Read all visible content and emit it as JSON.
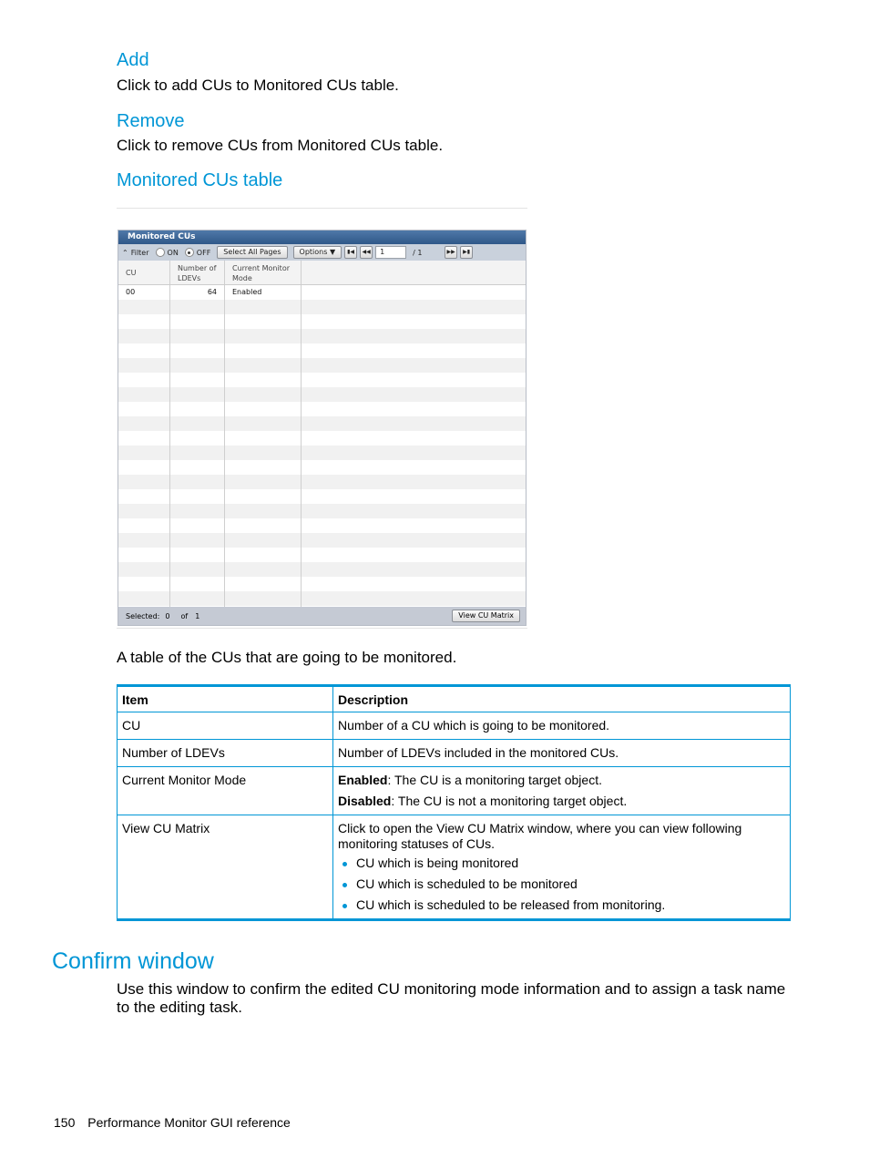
{
  "sections": {
    "add": {
      "title": "Add",
      "text": "Click to add CUs to Monitored CUs table."
    },
    "remove": {
      "title": "Remove",
      "text": "Click to remove CUs from Monitored CUs table."
    },
    "monitored_table": {
      "title": "Monitored CUs table",
      "caption": "A table of the CUs that are going to be monitored."
    }
  },
  "window": {
    "title": "Monitored CUs",
    "toolbar": {
      "filter_label": "Filter",
      "on_label": "ON",
      "off_label": "OFF",
      "filter_state": "OFF",
      "select_all_pages": "Select All Pages",
      "options": "Options",
      "page_current": "1",
      "page_total": "/ 1"
    },
    "columns": [
      "CU",
      "Number of LDEVs",
      "Current Monitor Mode"
    ],
    "rows": [
      {
        "cu": "00",
        "ldevs": "64",
        "mode": "Enabled"
      }
    ],
    "footer": {
      "selected_label": "Selected:",
      "selected_count": "0",
      "of_label": "of",
      "total": "1",
      "view_button": "View CU Matrix"
    }
  },
  "desc_table": {
    "headers": {
      "item": "Item",
      "description": "Description"
    },
    "rows": [
      {
        "item": "CU",
        "description": "Number of a CU which is going to be monitored."
      },
      {
        "item": "Number of LDEVs",
        "description": "Number of LDEVs included in the monitored CUs."
      },
      {
        "item": "Current Monitor Mode",
        "enabled_term": "Enabled",
        "enabled_text": ": The CU is a monitoring target object.",
        "disabled_term": "Disabled",
        "disabled_text": ": The CU is not a monitoring target object."
      },
      {
        "item": "View CU Matrix",
        "description": "Click to open the View CU Matrix window, where you can view following monitoring statuses of CUs.",
        "bullets": [
          "CU which is being monitored",
          "CU which is scheduled to be monitored",
          "CU which is scheduled to be released from monitoring."
        ]
      }
    ]
  },
  "confirm": {
    "title": "Confirm window",
    "text": "Use this window to confirm the edited CU monitoring mode information and to assign a task name to the editing task."
  },
  "footer": {
    "page_number": "150",
    "section": "Performance Monitor GUI reference"
  },
  "colors": {
    "accent": "#0096d6",
    "title_bar": "#2f5889"
  }
}
